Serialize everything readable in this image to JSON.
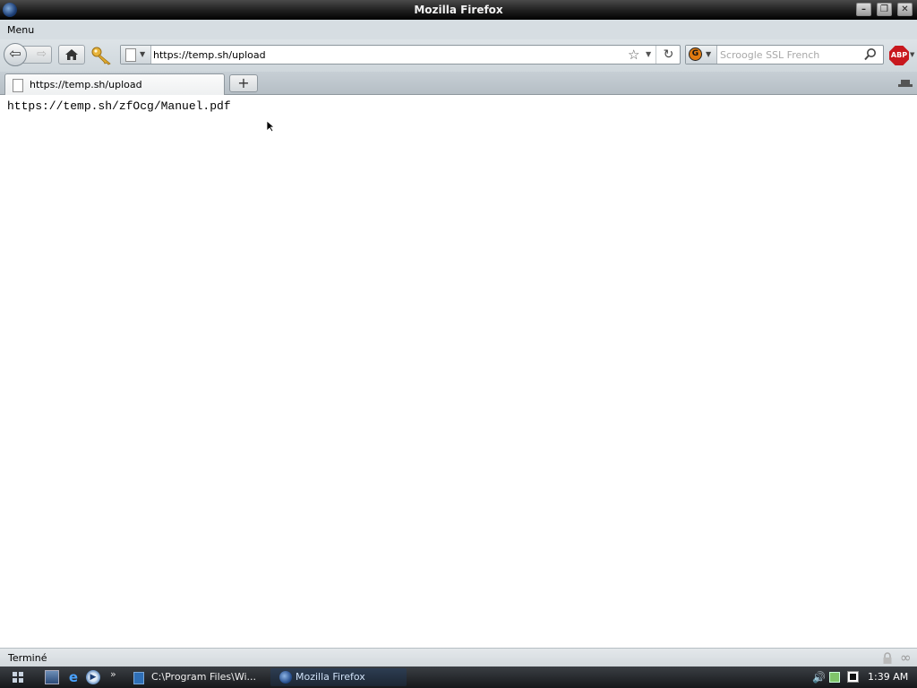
{
  "window": {
    "title": "Mozilla Firefox"
  },
  "menubar": {
    "menu_label": "Menu"
  },
  "toolbar": {
    "url": "https://temp.sh/upload",
    "search_placeholder": "Scroogle SSL French",
    "abp_label": "ABP"
  },
  "tabs": [
    {
      "label": "https://temp.sh/upload"
    }
  ],
  "content": {
    "text": "https://temp.sh/zfOcg/Manuel.pdf"
  },
  "statusbar": {
    "status": "Terminé"
  },
  "taskbar": {
    "tasks": [
      {
        "label": "C:\\Program Files\\Wi..."
      },
      {
        "label": "Mozilla Firefox"
      }
    ],
    "clock": "1:39 AM"
  },
  "colors": {
    "abp": "#c8181e",
    "titlebar": "#1e1e1e",
    "chrome": "#d6dde2"
  },
  "icons": [
    "back-icon",
    "forward-icon",
    "home-icon",
    "key-icon",
    "page-icon",
    "bookmark-star-icon",
    "reload-icon",
    "search-engine-icon",
    "magnifier-icon",
    "adblock-icon",
    "new-tab-icon",
    "list-tabs-icon",
    "lock-icon",
    "windows-start-icon",
    "volume-icon",
    "network-icon"
  ]
}
